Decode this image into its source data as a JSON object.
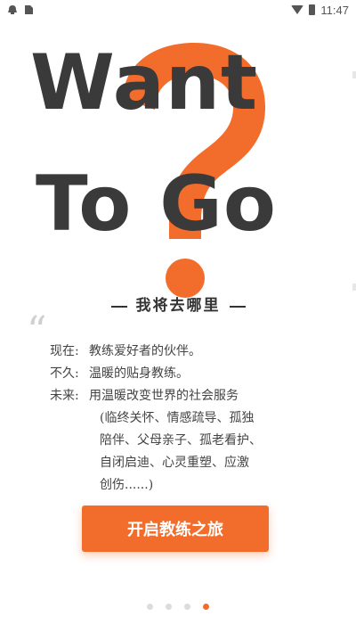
{
  "status_bar": {
    "time": "11:47"
  },
  "hero": {
    "line1": "Want",
    "line2": "To Go",
    "accent_color": "#f26d2b",
    "text_color": "#3a3a3a",
    "icon": "question-mark-icon"
  },
  "subtitle": "我将去哪里",
  "description": {
    "now_label": "现在:",
    "now_text": "教练爱好者的伙伴。",
    "soon_label": "不久:",
    "soon_text": "温暖的贴身教练。",
    "future_label": "未来:",
    "future_text": "用温暖改变世界的社会服务",
    "services_line1": "(临终关怀、情感疏导、孤独",
    "services_line2": "陪伴、父母亲子、孤老看护、",
    "services_line3": "自闭启迪、心灵重塑、应激",
    "services_line4": "创伤......)"
  },
  "cta_label": "开启教练之旅",
  "pagination": {
    "total": 4,
    "active_index": 3
  }
}
